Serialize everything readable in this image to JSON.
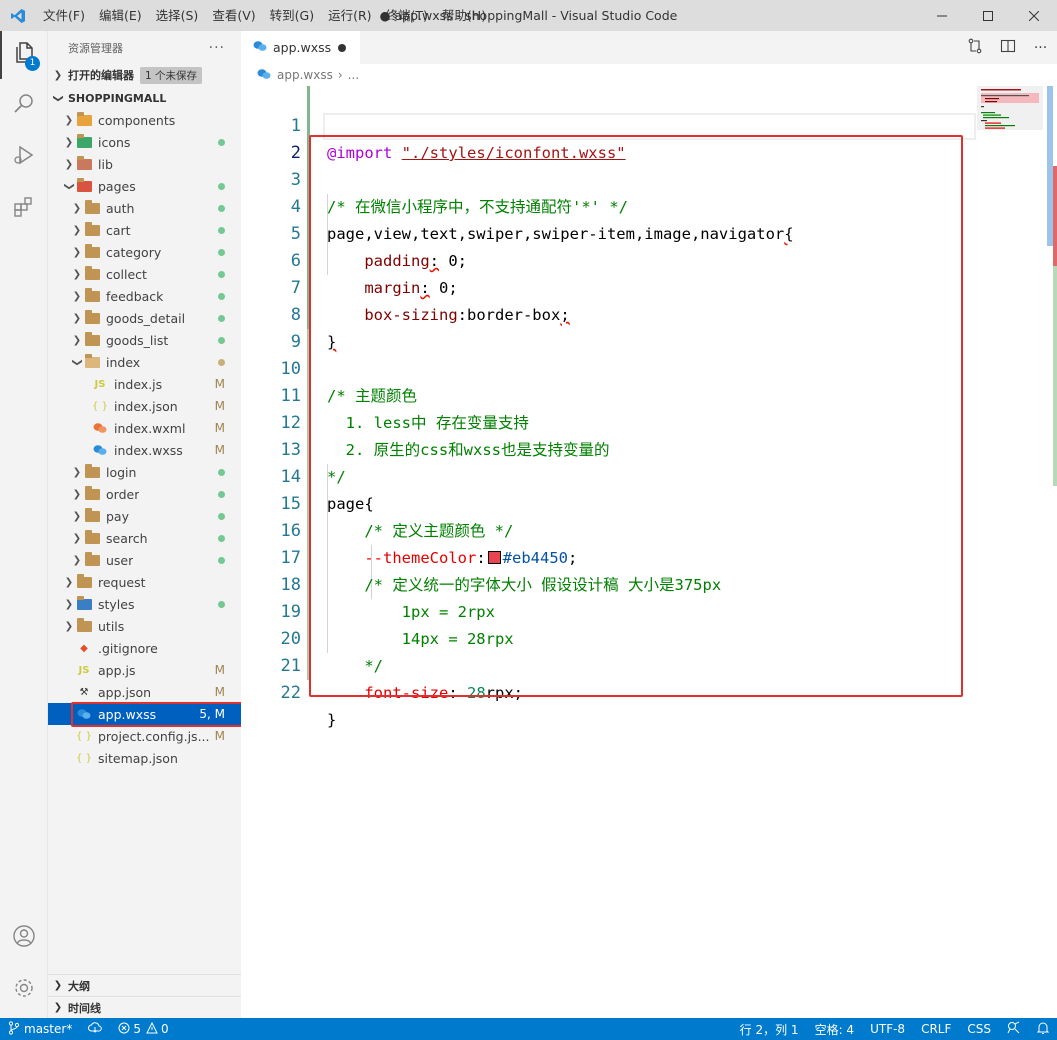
{
  "titlebar": {
    "menu": [
      "文件(F)",
      "编辑(E)",
      "选择(S)",
      "查看(V)",
      "转到(G)",
      "运行(R)",
      "终端(T)",
      "帮助(H)"
    ],
    "title": "● app.wxss - shoppingMall - Visual Studio Code"
  },
  "activity": {
    "badge": "1"
  },
  "sidebar": {
    "title": "资源管理器",
    "more": "···",
    "open_editors": "打开的编辑器",
    "unsaved": "1 个未保存",
    "project": "SHOPPINGMALL",
    "items": [
      {
        "label": "components",
        "deco": ""
      },
      {
        "label": "icons",
        "deco": "dot"
      },
      {
        "label": "lib",
        "deco": ""
      },
      {
        "label": "pages",
        "deco": "dot"
      },
      {
        "label": "auth",
        "deco": "dot"
      },
      {
        "label": "cart",
        "deco": "dot"
      },
      {
        "label": "category",
        "deco": "dot"
      },
      {
        "label": "collect",
        "deco": "dot"
      },
      {
        "label": "feedback",
        "deco": "dot"
      },
      {
        "label": "goods_detail",
        "deco": "dot"
      },
      {
        "label": "goods_list",
        "deco": "dot"
      },
      {
        "label": "index",
        "deco": "moddot"
      },
      {
        "label": "index.js",
        "deco": "M"
      },
      {
        "label": "index.json",
        "deco": "M"
      },
      {
        "label": "index.wxml",
        "deco": "M"
      },
      {
        "label": "index.wxss",
        "deco": "M"
      },
      {
        "label": "login",
        "deco": "dot"
      },
      {
        "label": "order",
        "deco": "dot"
      },
      {
        "label": "pay",
        "deco": "dot"
      },
      {
        "label": "search",
        "deco": "dot"
      },
      {
        "label": "user",
        "deco": "dot"
      },
      {
        "label": "request",
        "deco": ""
      },
      {
        "label": "styles",
        "deco": "dot"
      },
      {
        "label": "utils",
        "deco": ""
      },
      {
        "label": ".gitignore",
        "deco": ""
      },
      {
        "label": "app.js",
        "deco": "M"
      },
      {
        "label": "app.json",
        "deco": "M"
      },
      {
        "label": "app.wxss",
        "deco": "5, M"
      },
      {
        "label": "project.config.js...",
        "deco": "M"
      },
      {
        "label": "sitemap.json",
        "deco": ""
      }
    ],
    "outline": "大纲",
    "timeline": "时间线"
  },
  "editor": {
    "tab_label": "app.wxss",
    "breadcrumb_file": "app.wxss",
    "breadcrumb_more": "...",
    "line_numbers": [
      "1",
      "2",
      "3",
      "4",
      "5",
      "6",
      "7",
      "8",
      "9",
      "10",
      "11",
      "12",
      "13",
      "14",
      "15",
      "16",
      "17",
      "18",
      "19",
      "20",
      "21",
      "22"
    ]
  },
  "statusbar": {
    "branch": "master*",
    "errors": "5",
    "warnings": "0",
    "position": "行 2，列 1",
    "spaces": "空格: 4",
    "encoding": "UTF-8",
    "eol": "CRLF",
    "language": "CSS"
  }
}
